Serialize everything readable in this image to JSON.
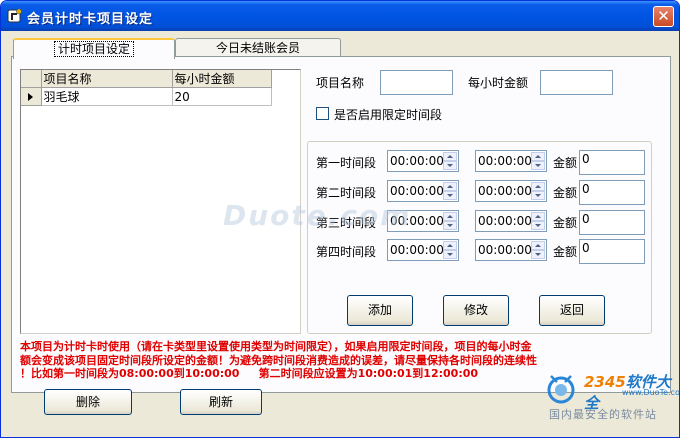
{
  "window": {
    "title": "会员计时卡项目设定",
    "close_glyph": "✕"
  },
  "tabs": [
    {
      "label": "计时项目设定",
      "active": true
    },
    {
      "label": "今日未结账会员",
      "active": false
    }
  ],
  "grid": {
    "columns": [
      "项目名称",
      "每小时金额"
    ],
    "rows": [
      {
        "name": "羽毛球",
        "amount": "20"
      }
    ]
  },
  "form": {
    "name_label": "项目名称",
    "name_value": "",
    "amount_label": "每小时金额",
    "amount_value": "",
    "limit_checkbox_label": "是否启用限定时间段",
    "limit_checked": false
  },
  "periods": [
    {
      "label": "第一时间段",
      "start": "00:00:00",
      "end": "00:00:00",
      "amount_label": "金额",
      "amount": "0"
    },
    {
      "label": "第二时间段",
      "start": "00:00:00",
      "end": "00:00:00",
      "amount_label": "金额",
      "amount": "0"
    },
    {
      "label": "第三时间段",
      "start": "00:00:00",
      "end": "00:00:00",
      "amount_label": "金额",
      "amount": "0"
    },
    {
      "label": "第四时间段",
      "start": "00:00:00",
      "end": "00:00:00",
      "amount_label": "金额",
      "amount": "0"
    }
  ],
  "actions": {
    "add": "添加",
    "edit": "修改",
    "back": "返回",
    "delete": "删除",
    "refresh": "刷新"
  },
  "note": {
    "line1": "本项目为计时卡时使用（请在卡类型里设置使用类型为时间限定），如果启用限定时间段，项目的每小时金",
    "line2": "额会变成该项目固定时间段所设定的金额！为避免跨时间段消费造成的误差，请尽量保持各时间段的连续性",
    "line3": "！比如第一时间段为08:00:00到10:00:00     第二时间段应设置为10:00:01到12:00:00"
  },
  "watermark": {
    "site": "Duote.com",
    "brand_number": "2345",
    "brand_suffix": "软件大全",
    "url": "www.DuoTe.com",
    "slogan": "国内最安全的软件站"
  },
  "colors": {
    "titlebar": "#0054e3",
    "note_text": "#e00000",
    "tab_highlight": "#ffc83c"
  },
  "icons": {
    "app": "gear-wrench-icon",
    "close": "close-icon",
    "row_indicator": "arrow-right-icon",
    "spinner": "spin-arrows-icon"
  }
}
